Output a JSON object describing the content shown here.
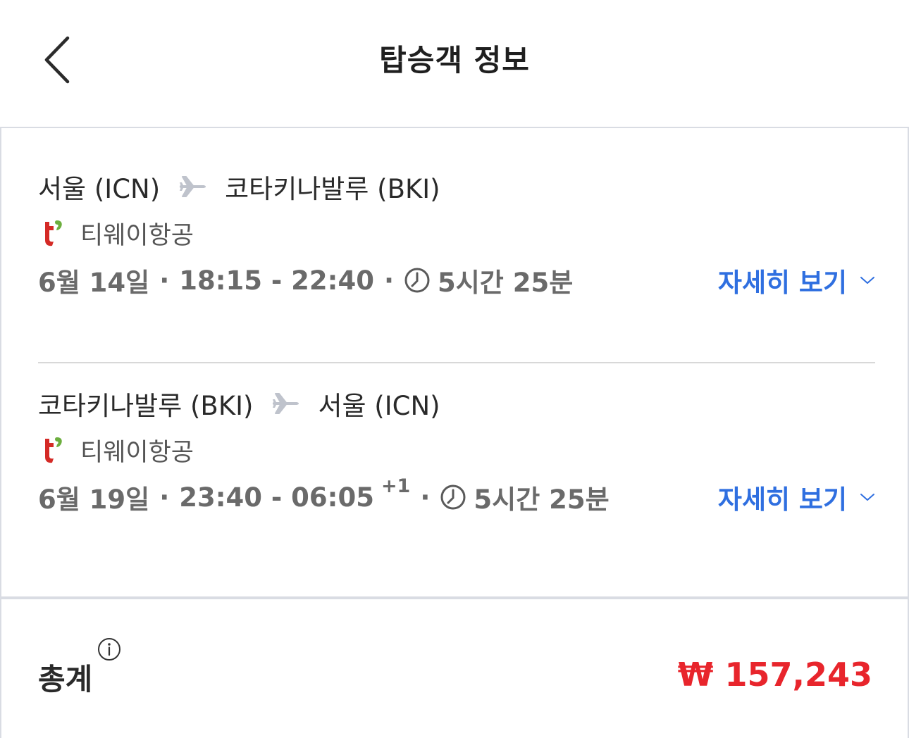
{
  "header": {
    "title": "탑승객 정보",
    "back_icon": "chevron-left-icon"
  },
  "legs": [
    {
      "origin": "서울 (ICN)",
      "destination": "코타키나발루 (BKI)",
      "airline": "티웨이항공",
      "date": "6월 14일",
      "time_range": "18:15 - 22:40",
      "day_offset": "",
      "duration": "5시간 25분",
      "details_label": "자세히 보기"
    },
    {
      "origin": "코타키나발루 (BKI)",
      "destination": "서울 (ICN)",
      "airline": "티웨이항공",
      "date": "6월 19일",
      "time_range": "23:40 - 06:05",
      "day_offset": "+1",
      "duration": "5시간 25분",
      "details_label": "자세히 보기"
    }
  ],
  "separator": "·",
  "total": {
    "label": "총계",
    "amount": "₩ 157,243"
  },
  "colors": {
    "link": "#2f6fe0",
    "price": "#e8252c",
    "airline_logo_red": "#d42a26",
    "airline_logo_green": "#6cae3e"
  },
  "icons": {
    "plane": "airplane-icon",
    "clock": "clock-icon",
    "chevron": "chevron-down-icon",
    "info": "info-icon",
    "airline_logo": "tway-logo-icon"
  }
}
